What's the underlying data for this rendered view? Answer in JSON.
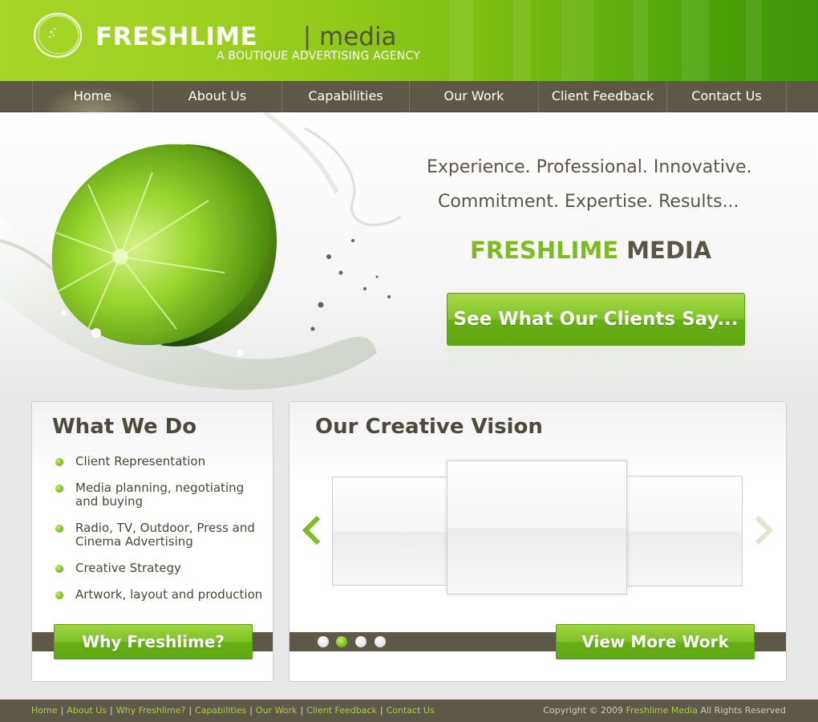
{
  "brand": {
    "name": "FRESHLIME",
    "separator": "|",
    "suffix": "media",
    "tagline": "A BOUTIQUE ADVERTISING AGENCY"
  },
  "nav": {
    "items": [
      {
        "label": "Home",
        "active": true
      },
      {
        "label": "About Us"
      },
      {
        "label": "Capabilities"
      },
      {
        "label": "Our Work"
      },
      {
        "label": "Client Feedback"
      },
      {
        "label": "Contact Us"
      }
    ]
  },
  "hero": {
    "line1": "Experience. Professional. Innovative.",
    "line2": "Commitment. Expertise. Results...",
    "title_green": "FRESHLIME",
    "title_dark": "MEDIA",
    "cta_label": "See What Our Clients Say..."
  },
  "what_we_do": {
    "title": "What We Do",
    "items": [
      "Client Representation",
      "Media planning, negotiating and buying",
      "Radio, TV, Outdoor, Press and Cinema Advertising",
      "Creative Strategy",
      "Artwork, layout and production"
    ],
    "button_label": "Why Freshlime?"
  },
  "vision": {
    "title": "Our Creative Vision",
    "button_label": "View More Work",
    "pager": {
      "count": 4,
      "active_index": 1
    }
  },
  "footer": {
    "links": [
      "Home",
      "About Us",
      "Why Freshlime?",
      "Capabilities",
      "Our Work",
      "Client Feedback",
      "Contact Us"
    ],
    "separator": "|",
    "copyright_prefix": "Copyright © 2009",
    "copyright_brand": "Freshlime Media",
    "copyright_suffix": "All Rights Reserved"
  },
  "colors": {
    "lime_green": "#7cbc1e",
    "header_green": "#98cc1c",
    "nav_brown": "#5e5848",
    "text_dark": "#4d4a3c"
  }
}
